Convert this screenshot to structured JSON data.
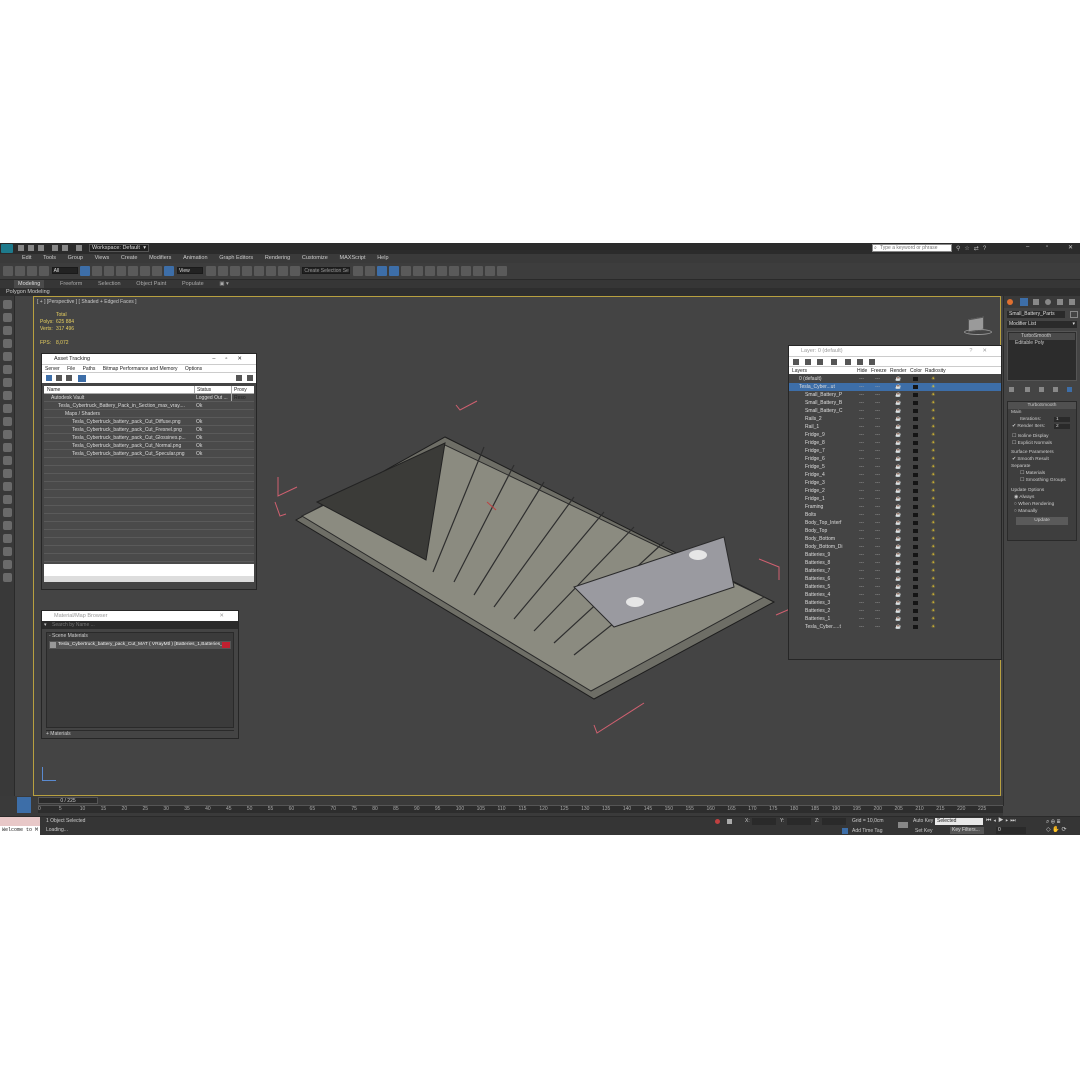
{
  "titlebar": {
    "workspace": "Workspace: Default",
    "search_placeholder": "Type a keyword or phrase"
  },
  "menu": [
    "Edit",
    "Tools",
    "Group",
    "Views",
    "Create",
    "Modifiers",
    "Animation",
    "Graph Editors",
    "Rendering",
    "Customize",
    "MAXScript",
    "Help"
  ],
  "toolbar": {
    "filter": "All",
    "view": "View",
    "selection_set": "Create Selection Se"
  },
  "ribbon": {
    "tabs": [
      "Modeling",
      "Freeform",
      "Selection",
      "Object Paint",
      "Populate"
    ],
    "sub": "Polygon Modeling"
  },
  "viewport": {
    "label": "[ + ] [Perspective ] [ Shaded + Edged Faces ]",
    "stats": {
      "total": "Total",
      "polys_label": "Polys:",
      "polys": "625 884",
      "verts_label": "Verts:",
      "verts": "317 496",
      "fps_label": "FPS:",
      "fps": "8,072"
    }
  },
  "asset_tracking": {
    "title": "Asset Tracking",
    "menu": [
      "Server",
      "File",
      "Paths",
      "Bitmap Performance and Memory",
      "Options"
    ],
    "columns": [
      "Name",
      "Status",
      "Proxy Reso"
    ],
    "rows": [
      {
        "name": "Autodesk Vault",
        "status": "Logged Out ...",
        "indent": 1
      },
      {
        "name": "Tesla_Cybertruck_Battery_Pack_in_Section_max_vray....",
        "status": "Ok",
        "indent": 2
      },
      {
        "name": "Maps / Shaders",
        "status": "",
        "indent": 3
      },
      {
        "name": "Tesla_Cybertruck_battery_pack_Cut_Diffuse.png",
        "status": "Ok",
        "indent": 4
      },
      {
        "name": "Tesla_Cybertruck_battery_pack_Cut_Fresnel.png",
        "status": "Ok",
        "indent": 4
      },
      {
        "name": "Tesla_Cybertruck_battery_pack_Cut_Glossines.p...",
        "status": "Ok",
        "indent": 4
      },
      {
        "name": "Tesla_Cybertruck_battery_pack_Cut_Normal.png",
        "status": "Ok",
        "indent": 4
      },
      {
        "name": "Tesla_Cybertruck_battery_pack_Cut_Specular.png",
        "status": "Ok",
        "indent": 4
      }
    ]
  },
  "material_browser": {
    "title": "Material/Map Browser",
    "search_placeholder": "Search by Name ...",
    "section": "- Scene Materials",
    "material": "Tesla_Cybertruck_battery_pack_Cut_MAT ( VRayMtl ) [Batteries_1,Batteries_",
    "footer": "+ Materials"
  },
  "layer_explorer": {
    "title": "Layer: 0 (default)",
    "columns": [
      "Layers",
      "Hide",
      "Freeze",
      "Render",
      "Color",
      "Radiosity"
    ],
    "layers": [
      "0 (default)",
      "Tesla_Cyber...ut",
      "Small_Battery_P",
      "Small_Battery_B",
      "Small_Battery_C",
      "Rails_2",
      "Rail_1",
      "Fridge_9",
      "Fridge_8",
      "Fridge_7",
      "Fridge_6",
      "Fridge_5",
      "Fridge_4",
      "Fridge_3",
      "Fridge_2",
      "Fridge_1",
      "Framing",
      "Bolts",
      "Body_Top_Interf",
      "Body_Top",
      "Body_Bottom",
      "Body_Bottom_Di",
      "Batteries_9",
      "Batteries_8",
      "Batteries_7",
      "Batteries_6",
      "Batteries_5",
      "Batteries_4",
      "Batteries_3",
      "Batteries_2",
      "Batteries_1",
      "Tesla_Cyber.....t"
    ]
  },
  "command_panel": {
    "object_name": "Small_Battery_Parts",
    "modifier_list": "Modifier List",
    "stack": [
      "TurboSmooth",
      "Editable Poly"
    ],
    "rollout": "TurboSmooth",
    "main": "Main",
    "iterations_label": "Iterations:",
    "iterations": "1",
    "render_iters_label": "Render Iters:",
    "render_iters": "2",
    "isoline": "Isoline Display",
    "explicit": "Explicit Normals",
    "surface": "Surface Parameters",
    "smooth": "Smooth Result",
    "separate": "Separate",
    "materials": "Materials",
    "smoothing_groups": "Smoothing Groups",
    "update_options": "Update Options",
    "always": "Always",
    "when_rendering": "When Rendering",
    "manually": "Manually",
    "update_button": "Update"
  },
  "timeline": {
    "frame": "0 / 225",
    "ticks": [
      "0",
      "5",
      "10",
      "15",
      "20",
      "25",
      "30",
      "35",
      "40",
      "45",
      "50",
      "55",
      "60",
      "65",
      "70",
      "75",
      "80",
      "85",
      "90",
      "95",
      "100",
      "105",
      "110",
      "115",
      "120",
      "125",
      "130",
      "135",
      "140",
      "145",
      "150",
      "155",
      "160",
      "165",
      "170",
      "175",
      "180",
      "185",
      "190",
      "195",
      "200",
      "205",
      "210",
      "215",
      "220",
      "225"
    ]
  },
  "status": {
    "welcome": "Welcome to M",
    "selected": "1 Object Selected",
    "loading": "Loading...",
    "x": "X:",
    "y": "Y:",
    "z": "Z:",
    "grid": "Grid = 10,0cm",
    "add_time_tag": "Add Time Tag",
    "auto_key": "Auto Key",
    "set_key": "Set Key",
    "selected_dd": "Selected",
    "key_filters": "Key Filters...",
    "frame_value": "0"
  },
  "colors": {
    "accent": "#3d6ea8",
    "viewport_border": "#b8a040",
    "selection_box": "#d06070"
  }
}
